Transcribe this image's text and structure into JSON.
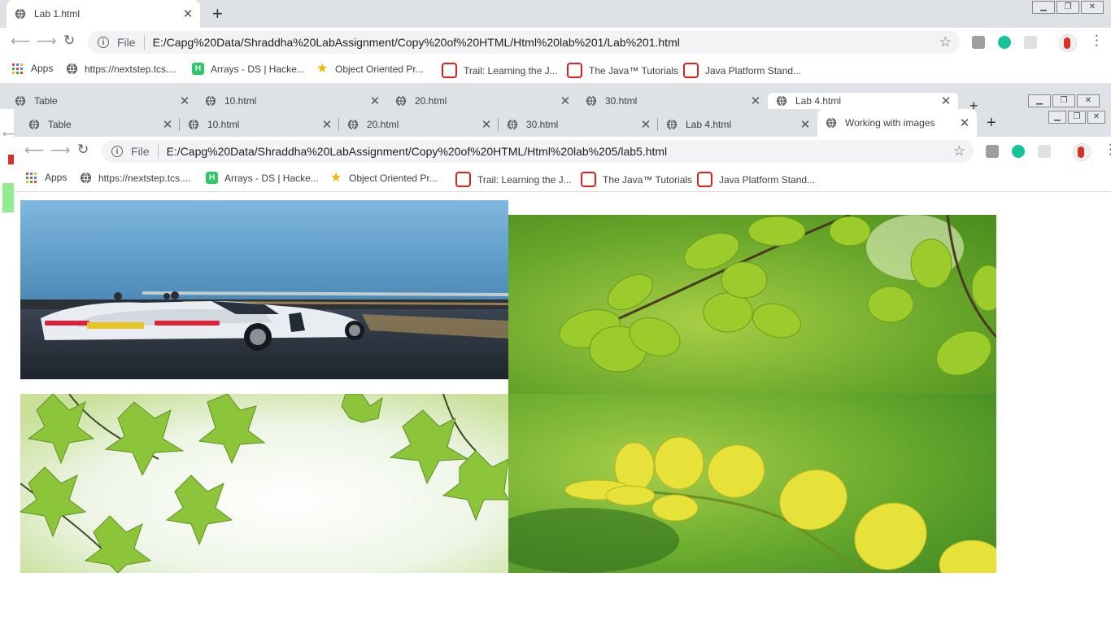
{
  "back_window": {
    "tabs": [
      {
        "title": "Lab 1.html"
      }
    ],
    "url": "E:/Capg%20Data/Shraddha%20LabAssignment/Copy%20of%20HTML/Html%20lab%201/Lab%201.html",
    "file_label": "File"
  },
  "middle_window": {
    "tabs": [
      {
        "title": "Table"
      },
      {
        "title": "10.html"
      },
      {
        "title": "20.html"
      },
      {
        "title": "30.html"
      },
      {
        "title": "Lab 4.html"
      }
    ]
  },
  "front_window": {
    "tabs": [
      {
        "title": "Table"
      },
      {
        "title": "10.html"
      },
      {
        "title": "20.html"
      },
      {
        "title": "30.html"
      },
      {
        "title": "Lab 4.html"
      },
      {
        "title": "Working with images"
      }
    ],
    "url": "E:/Capg%20Data/Shraddha%20LabAssignment/Copy%20of%20HTML/Html%20lab%205/lab5.html",
    "file_label": "File"
  },
  "bookmarks": [
    {
      "label": "Apps",
      "icon": "apps-grid-icon"
    },
    {
      "label": "https://nextstep.tcs....",
      "icon": "globe-icon"
    },
    {
      "label": "Arrays - DS | Hacke...",
      "icon": "hackerrank-icon"
    },
    {
      "label": "Object Oriented Pr...",
      "icon": "star-bookmark-icon"
    },
    {
      "label": "Trail: Learning the J...",
      "icon": "oracle-icon"
    },
    {
      "label": "The Java™ Tutorials",
      "icon": "oracle-icon"
    },
    {
      "label": "Java Platform Stand...",
      "icon": "oracle-icon"
    }
  ],
  "page": {
    "images": [
      {
        "subject": "white sports car on road at dusk"
      },
      {
        "subject": "green leaves on branch"
      },
      {
        "subject": "maple leaves with bokeh"
      },
      {
        "subject": "yellow-green leaves on twig"
      }
    ]
  },
  "colors": {
    "tab_strip": "#dee1e6",
    "omnibox": "#f1f3f4",
    "grammarly_green": "#15c39a",
    "profile_red": "#d93025",
    "oracle_red": "#e01e1e",
    "hackerrank_green": "#2ec866"
  }
}
